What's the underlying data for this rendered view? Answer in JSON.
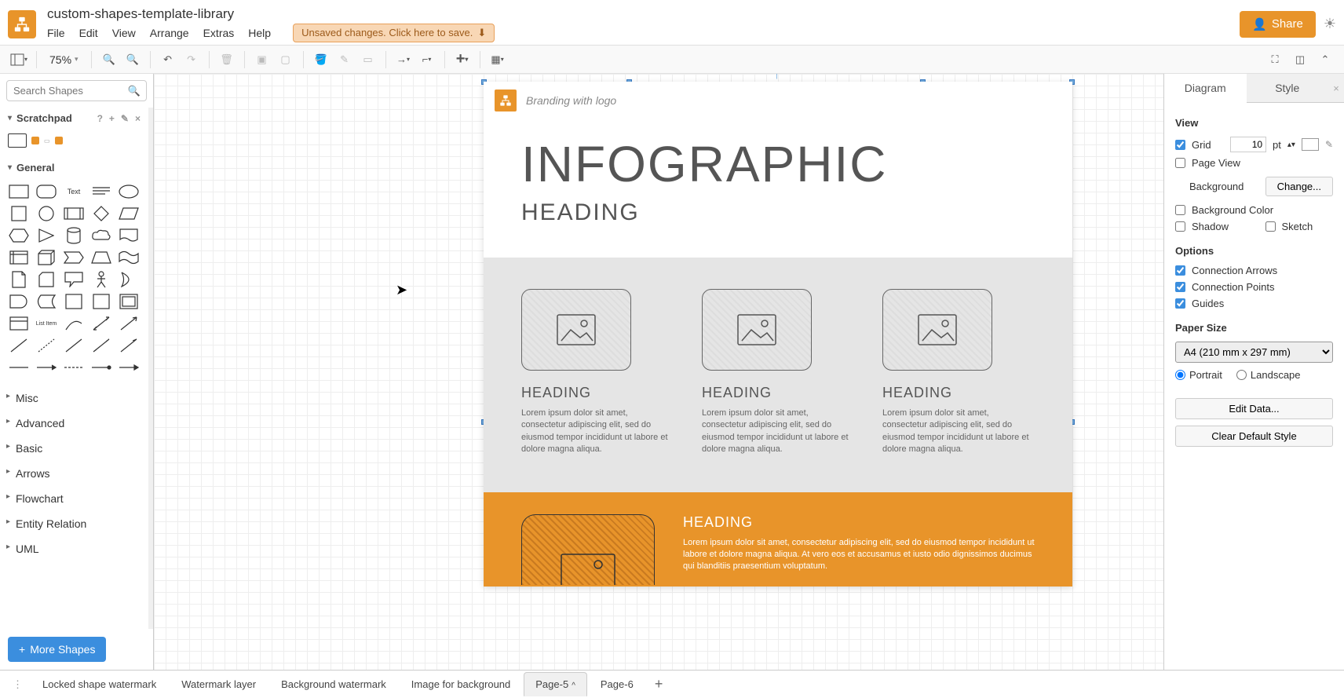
{
  "header": {
    "title": "custom-shapes-template-library",
    "menu": [
      "File",
      "Edit",
      "View",
      "Arrange",
      "Extras",
      "Help"
    ],
    "save_notice": "Unsaved changes. Click here to save.",
    "share": "Share"
  },
  "toolbar": {
    "zoom": "75%"
  },
  "left": {
    "search_placeholder": "Search Shapes",
    "scratchpad": "Scratchpad",
    "general": "General",
    "categories": [
      "Misc",
      "Advanced",
      "Basic",
      "Arrows",
      "Flowchart",
      "Entity Relation",
      "UML"
    ],
    "more_shapes": "More Shapes"
  },
  "canvas": {
    "brand": "Branding with logo",
    "big_title": "INFOGRAPHIC",
    "sub_title": "HEADING",
    "card_heading": "HEADING",
    "lorem": "Lorem ipsum dolor sit amet, consectetur adipiscing elit, sed do eiusmod tempor incididunt ut labore et dolore magna aliqua.",
    "orange_heading": "HEADING",
    "orange_lorem": "Lorem ipsum dolor sit amet, consectetur adipiscing elit, sed do eiusmod tempor incididunt ut labore et dolore magna aliqua. At vero eos et accusamus et iusto odio dignissimos ducimus qui blanditiis praesentium voluptatum."
  },
  "right": {
    "tab_diagram": "Diagram",
    "tab_style": "Style",
    "view": "View",
    "grid": "Grid",
    "grid_size": "10",
    "grid_unit": "pt",
    "page_view": "Page View",
    "background": "Background",
    "change": "Change...",
    "bg_color": "Background Color",
    "shadow": "Shadow",
    "sketch": "Sketch",
    "options": "Options",
    "conn_arrows": "Connection Arrows",
    "conn_points": "Connection Points",
    "guides": "Guides",
    "paper_size": "Paper Size",
    "paper_sel": "A4 (210 mm x 297 mm)",
    "portrait": "Portrait",
    "landscape": "Landscape",
    "edit_data": "Edit Data...",
    "clear_style": "Clear Default Style"
  },
  "bottom": {
    "tabs": [
      "Locked shape watermark",
      "Watermark layer",
      "Background watermark",
      "Image for background",
      "Page-5",
      "Page-6"
    ],
    "active_index": 4
  }
}
